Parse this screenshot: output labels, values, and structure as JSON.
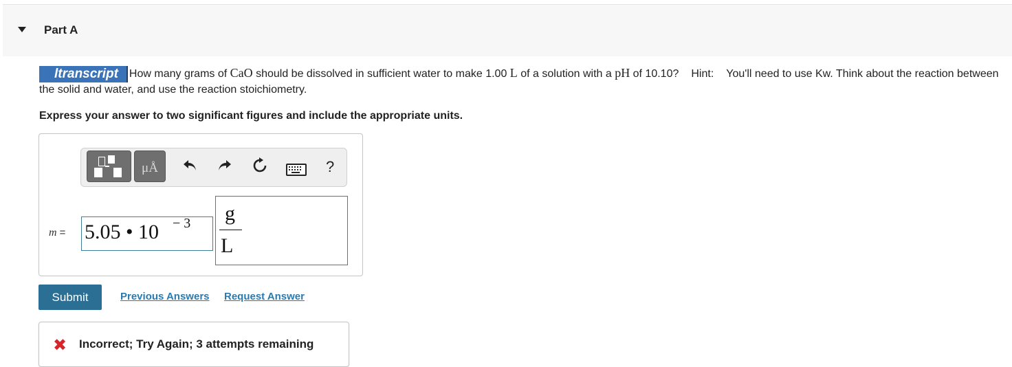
{
  "part": {
    "title": "Part A",
    "caret_icon": "caret-down-icon"
  },
  "question": {
    "logo_text": "ltranscript",
    "text_1": "How many grams of ",
    "chem_1": "CaO",
    "text_2": " should be dissolved in sufficient water to make 1.00 ",
    "unit_l": "L",
    "text_3": " of a solution with a ",
    "ph": "pH",
    "text_4": " of 10.10?",
    "hint_label": "Hint:",
    "hint_text": "You'll need to use Kw. Think about the reaction between the solid and water, and use the reaction stoichiometry."
  },
  "instruction": "Express your answer to two significant figures and include the appropriate units.",
  "toolbar": {
    "templates_icon": "templates-icon",
    "units_glyph": "μÅ",
    "undo_icon": "undo-icon",
    "redo_icon": "redo-icon",
    "reset_icon": "reset-icon",
    "keyboard_icon": "keyboard-icon",
    "help_glyph": "?"
  },
  "answer": {
    "variable": "m",
    "equals": "=",
    "value": "5.05 • 10",
    "exponent": "− 3",
    "unit_numerator": "g",
    "unit_denominator": "L"
  },
  "actions": {
    "submit_label": "Submit",
    "previous_answers_label": "Previous Answers",
    "request_answer_label": "Request Answer"
  },
  "feedback": {
    "icon": "incorrect-x-icon",
    "message": "Incorrect; Try Again; 3 attempts remaining",
    "color": "#d7262b"
  },
  "colors": {
    "accent": "#2c6f94",
    "link": "#2a7ab0",
    "logo": "#3b73b9"
  }
}
